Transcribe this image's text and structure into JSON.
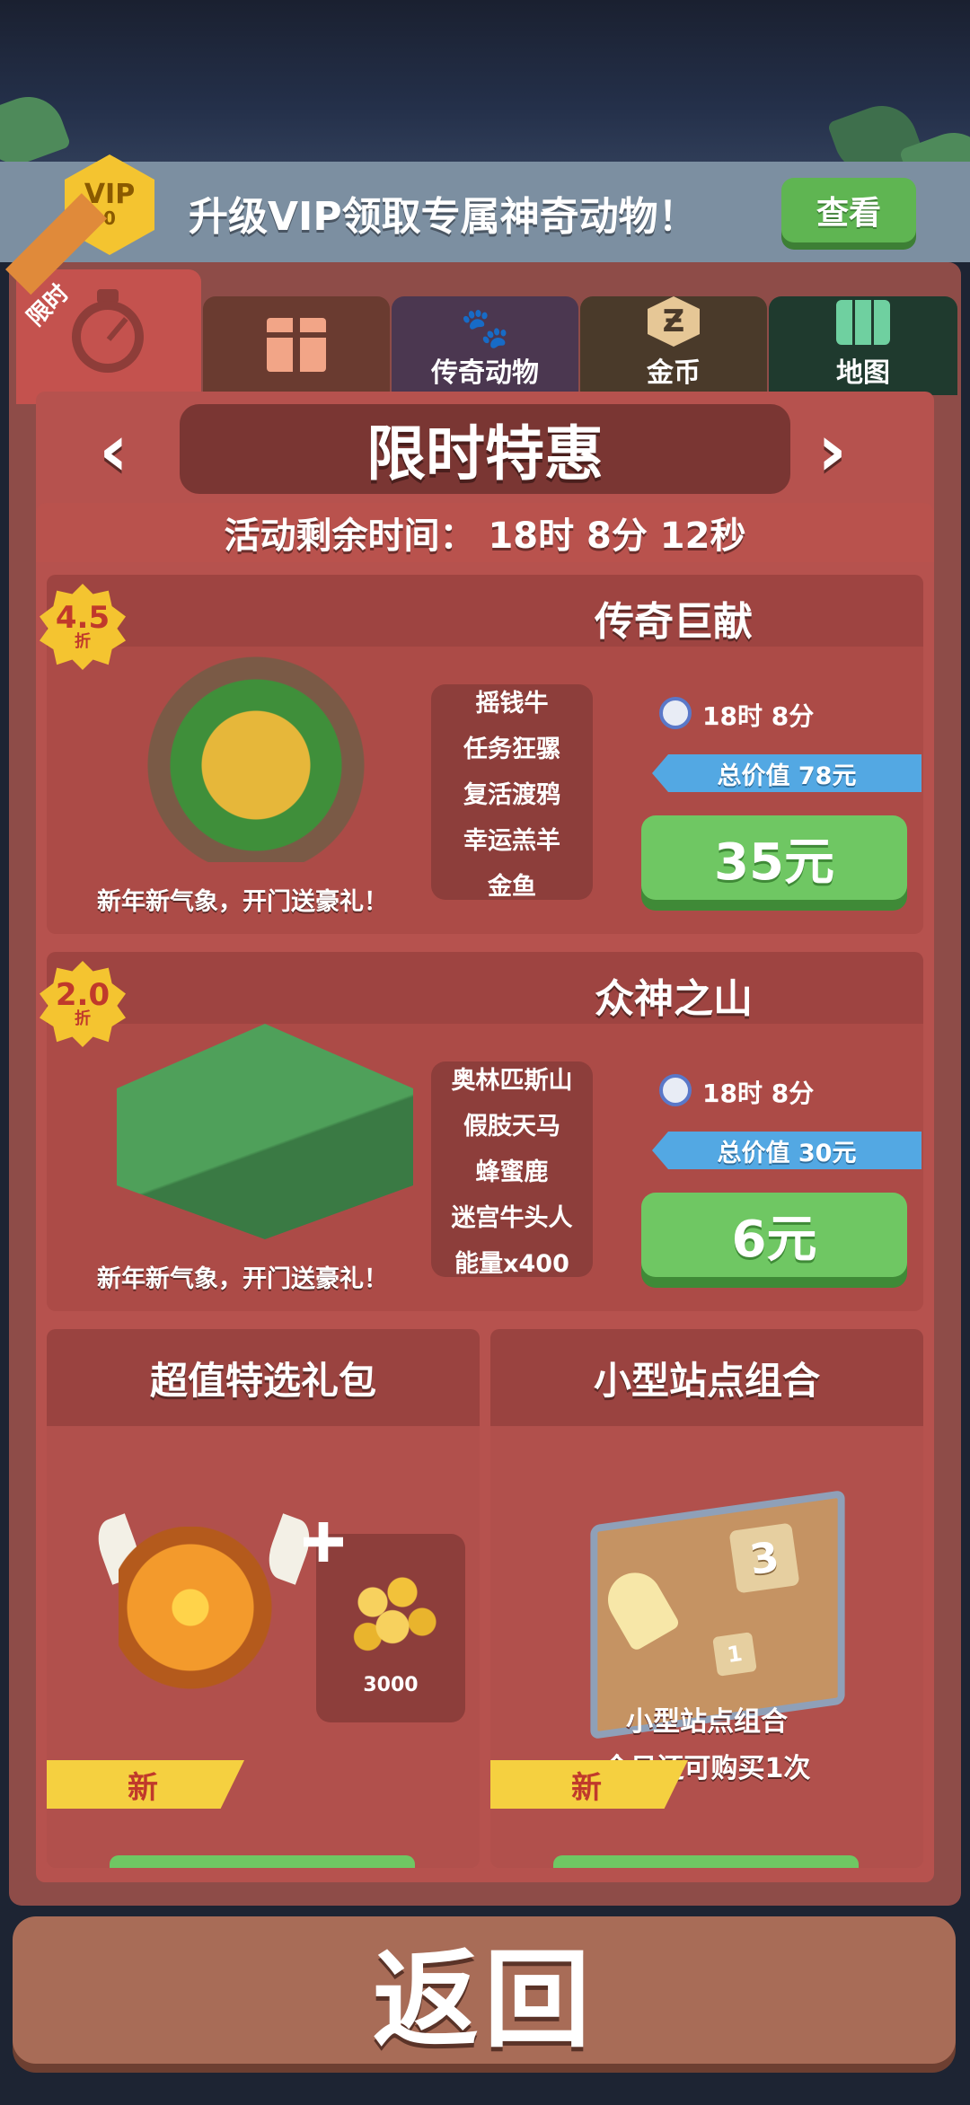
{
  "vip": {
    "badge_line1": "VIP",
    "badge_line2": "0",
    "promo_text": "升级VIP领取专属神奇动物！",
    "view_button": "查看"
  },
  "tabs": {
    "limited_ribbon": "限时",
    "items": [
      {
        "label": "",
        "icon": "gift-icon"
      },
      {
        "label": "传奇动物",
        "icon": "paw-icon"
      },
      {
        "label": "金币",
        "icon": "coin-icon"
      },
      {
        "label": "地图",
        "icon": "map-icon"
      }
    ],
    "coin_glyph": "Ƶ",
    "paw_glyph": "🐾"
  },
  "header": {
    "title": "限时特惠",
    "prev_arrow": "‹",
    "next_arrow": "›"
  },
  "timer": {
    "text": "活动剩余时间：  18时 8分 12秒"
  },
  "deals": [
    {
      "discount_value": "4.5",
      "discount_unit": "折",
      "title": "传奇巨献",
      "slogan": "新年新气象，开门送豪礼！",
      "contents": [
        "摇钱牛",
        "任务狂骡",
        "复活渡鸦",
        "幸运羔羊",
        "金鱼"
      ],
      "time_left": "18时 8分",
      "total_value": "总价值 78元",
      "price": "35元"
    },
    {
      "discount_value": "2.0",
      "discount_unit": "折",
      "title": "众神之山",
      "slogan": "新年新气象，开门送豪礼！",
      "contents": [
        "奥林匹斯山",
        "假肢天马",
        "蜂蜜鹿",
        "迷宫牛头人",
        "能量x400"
      ],
      "time_left": "18时 8分",
      "total_value": "总价值 30元",
      "price": "6元"
    }
  ],
  "packs": [
    {
      "title": "超值特选礼包",
      "coin_amount": "3000",
      "new_tag": "新"
    },
    {
      "title": "小型站点组合",
      "station_big": "3",
      "station_small": "1",
      "caption": "小型站点组合",
      "purchase_note": "今日还可购买1次",
      "new_tag": "新"
    }
  ],
  "footer": {
    "back_button": "返回"
  },
  "colors": {
    "panel": "#8e4c48",
    "price_green": "#6fc763",
    "total_blue": "#53a8e3",
    "badge_yellow": "#f4c430"
  }
}
